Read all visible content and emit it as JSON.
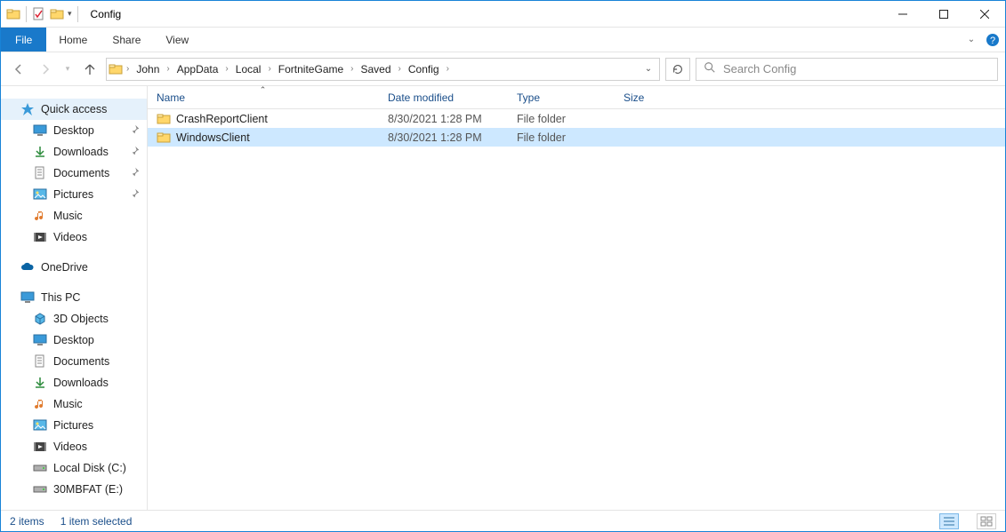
{
  "window": {
    "title": "Config"
  },
  "ribbon": {
    "file": "File",
    "tabs": [
      "Home",
      "Share",
      "View"
    ]
  },
  "breadcrumbs": [
    "John",
    "AppData",
    "Local",
    "FortniteGame",
    "Saved",
    "Config"
  ],
  "search": {
    "placeholder": "Search Config"
  },
  "sidebar": {
    "quick_access": "Quick access",
    "qa_items": [
      {
        "label": "Desktop",
        "pin": true,
        "icon": "desktop"
      },
      {
        "label": "Downloads",
        "pin": true,
        "icon": "downloads"
      },
      {
        "label": "Documents",
        "pin": true,
        "icon": "documents"
      },
      {
        "label": "Pictures",
        "pin": true,
        "icon": "pictures"
      },
      {
        "label": "Music",
        "pin": false,
        "icon": "music"
      },
      {
        "label": "Videos",
        "pin": false,
        "icon": "videos"
      }
    ],
    "onedrive": "OneDrive",
    "thispc": "This PC",
    "pc_items": [
      {
        "label": "3D Objects",
        "icon": "3d"
      },
      {
        "label": "Desktop",
        "icon": "desktop"
      },
      {
        "label": "Documents",
        "icon": "documents"
      },
      {
        "label": "Downloads",
        "icon": "downloads"
      },
      {
        "label": "Music",
        "icon": "music"
      },
      {
        "label": "Pictures",
        "icon": "pictures"
      },
      {
        "label": "Videos",
        "icon": "videos"
      },
      {
        "label": "Local Disk (C:)",
        "icon": "disk"
      },
      {
        "label": "30MBFAT (E:)",
        "icon": "disk"
      }
    ]
  },
  "columns": {
    "name": "Name",
    "date": "Date modified",
    "type": "Type",
    "size": "Size"
  },
  "files": [
    {
      "name": "CrashReportClient",
      "date": "8/30/2021 1:28 PM",
      "type": "File folder",
      "size": "",
      "selected": false
    },
    {
      "name": "WindowsClient",
      "date": "8/30/2021 1:28 PM",
      "type": "File folder",
      "size": "",
      "selected": true
    }
  ],
  "status": {
    "items": "2 items",
    "selected": "1 item selected"
  }
}
